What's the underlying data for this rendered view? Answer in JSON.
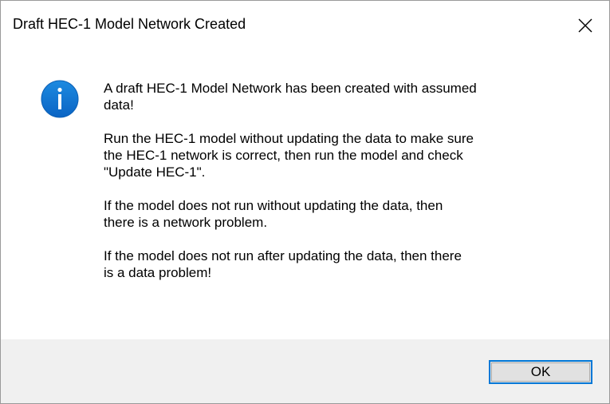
{
  "dialog": {
    "title": "Draft HEC-1 Model Network Created",
    "icon": "info-icon",
    "accent_color": "#0078d7",
    "messages": [
      "A draft HEC-1 Model Network has been created with assumed\ndata!",
      "Run the HEC-1 model without updating the data to make sure\nthe HEC-1 network is correct, then run the model and check\n\"Update HEC-1\".",
      "If the model does not run without updating the data, then\nthere is a network problem.",
      "If the model does not run after updating the data, then there\nis a data problem!"
    ],
    "ok_label": "OK",
    "close_icon": "close-icon"
  }
}
